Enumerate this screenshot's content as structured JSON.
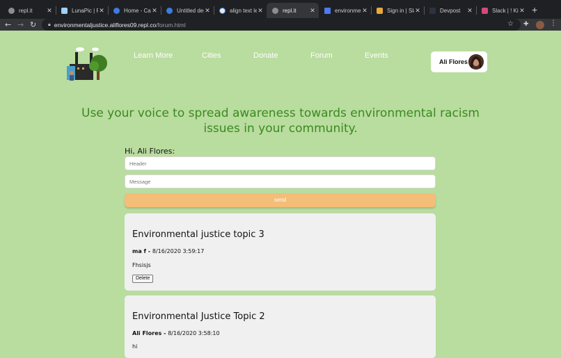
{
  "browser": {
    "tabs": [
      {
        "title": "repl.it",
        "color": "#8a8d91",
        "active": false
      },
      {
        "title": "LunaPic | Fr",
        "color": "#9fd0ff",
        "active": false
      },
      {
        "title": "Home - Can",
        "color": "#3d7be0",
        "active": false
      },
      {
        "title": "Untitled des",
        "color": "#3d7be0",
        "active": false
      },
      {
        "title": "align text lef",
        "color": "#e9e9e9",
        "active": false
      },
      {
        "title": "repl.it",
        "color": "#8a8d91",
        "active": true
      },
      {
        "title": "environment",
        "color": "#4b7bf0",
        "active": false
      },
      {
        "title": "Sign in | Sla",
        "color": "#e8a93a",
        "active": false
      },
      {
        "title": "Devpost",
        "color": "#2a3340",
        "active": false
      },
      {
        "title": "Slack | ! Kim",
        "color": "#d3497a",
        "active": false
      }
    ],
    "new_tab": "+",
    "url_host": "environmentaljustice.aliflores09.repl.co",
    "url_path": "/forum.html"
  },
  "nav": {
    "items": [
      "Learn More",
      "Cities",
      "Donate",
      "Forum",
      "Events"
    ]
  },
  "user": {
    "name": "Ali Flores"
  },
  "headline": "Use your voice to spread awareness towards environmental racism issues in your community.",
  "form": {
    "greeting": "Hi, Ali Flores:",
    "header_placeholder": "Header",
    "message_placeholder": "Message",
    "send_label": "send"
  },
  "posts": [
    {
      "title": "Environmental justice topic 3",
      "author": "ma f",
      "timestamp": "8/16/2020 3:59:17",
      "body": "Fhsisjs",
      "delete_label": "Delete"
    },
    {
      "title": "Environmental Justice Topic 2",
      "author": "Ali Flores",
      "timestamp": "8/16/2020 3:58:10",
      "body": "hi"
    }
  ],
  "colors": {
    "page_bg": "#b9dc9f",
    "headline": "#3a8a1f",
    "send_button": "#f4bd78"
  }
}
